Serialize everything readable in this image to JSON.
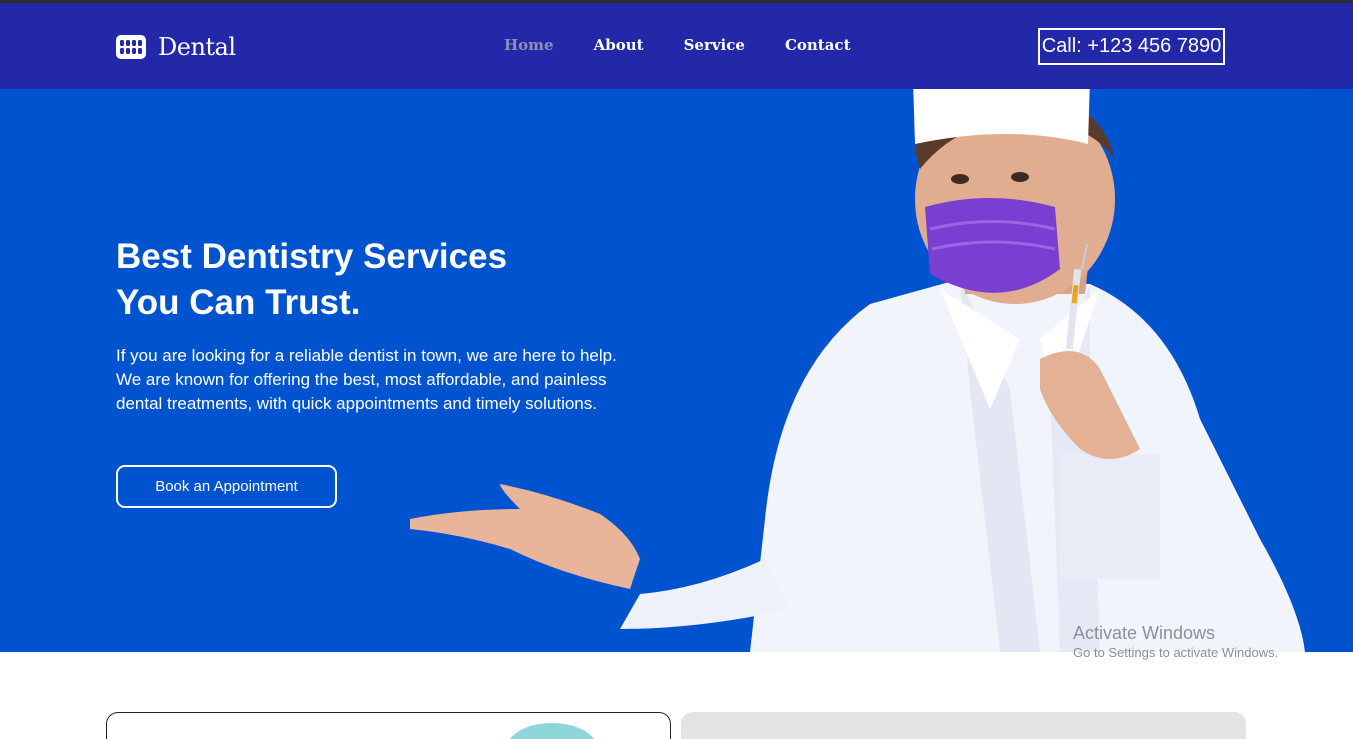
{
  "brand": {
    "name": "Dental",
    "icon": "teeth-icon"
  },
  "nav": {
    "links": [
      "Home",
      "About",
      "Service",
      "Contact"
    ],
    "active": "Home"
  },
  "call": {
    "label": "Call: +123 456 7890"
  },
  "hero": {
    "title_lines": [
      "Best Dentistry Services",
      "You Can Trust."
    ],
    "text_lines": [
      "If you are looking for a reliable dentist in town, we are here to help.",
      "We are known for offering the best, most affordable, and painless",
      "dental treatments, with quick appointments and timely solutions."
    ],
    "cta": "Book an Appointment",
    "image": "dentist-holding-syringe"
  },
  "watermark": {
    "title": "Activate Windows",
    "subtitle": "Go to Settings to activate Windows."
  },
  "colors": {
    "navbar": "#2328a8",
    "hero": "#0053cf",
    "nav_active": "#8f8fb8",
    "mask": "#7a3fd0"
  }
}
